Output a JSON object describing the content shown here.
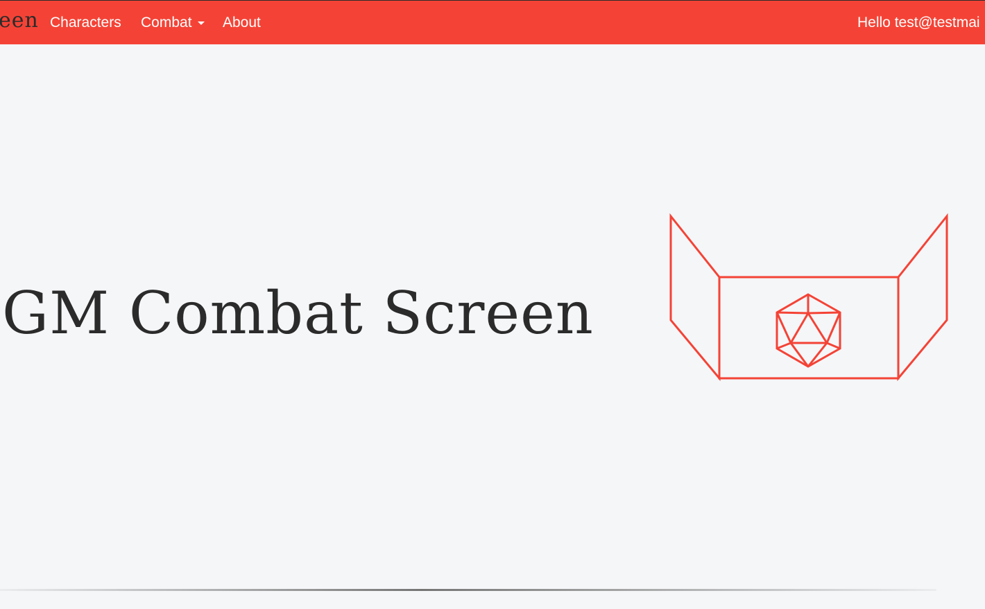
{
  "navbar": {
    "brand": "een",
    "links": [
      {
        "label": "Characters"
      },
      {
        "label": "Combat",
        "has_dropdown": true
      },
      {
        "label": "About"
      }
    ],
    "greeting": "Hello test@testmai"
  },
  "hero": {
    "title": "GM Combat Screen"
  },
  "colors": {
    "accent": "#f44336",
    "background": "#f5f6f8",
    "text": "#2b2b2b",
    "nav_text": "#ffffff"
  },
  "icons": {
    "logo": "gm-screen-d20-icon",
    "dropdown": "caret-down-icon"
  }
}
